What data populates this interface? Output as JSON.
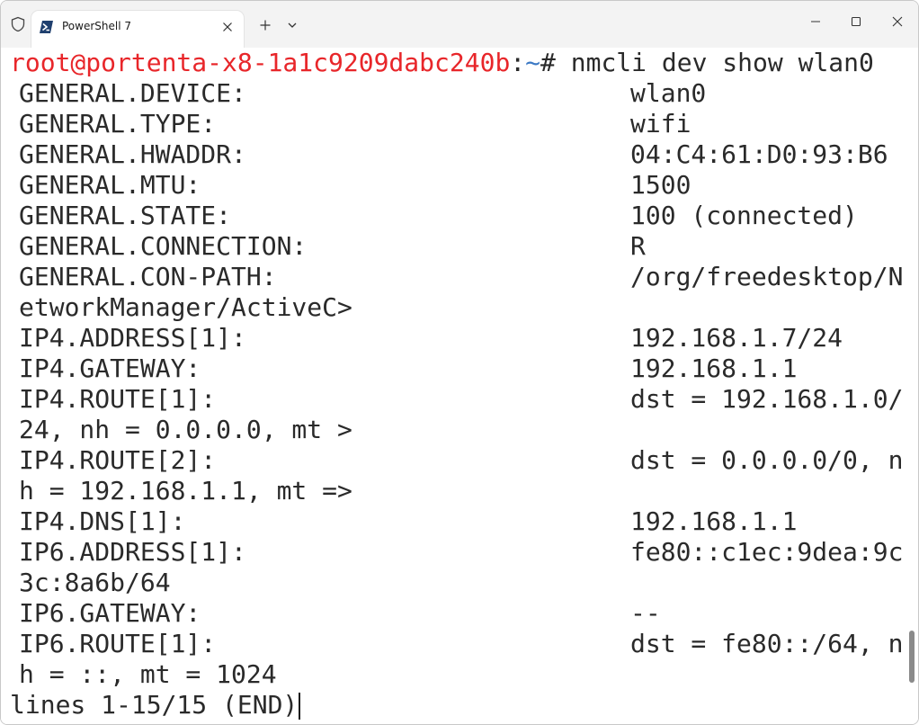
{
  "window": {
    "tab_title": "PowerShell 7",
    "icons": {
      "shield": "shield-icon",
      "tab": "powershell-icon",
      "tab_close": "close-icon",
      "new_tab": "plus-icon",
      "dropdown": "chevron-down-icon",
      "minimize": "minimize-icon",
      "maximize": "maximize-icon",
      "close": "close-window-icon"
    }
  },
  "terminal": {
    "prompt": {
      "user_host": "root@portenta-x8-1a1c9209dabc240b",
      "separator": ":",
      "path": "~",
      "symbol": "#",
      "command": " nmcli dev show wlan0"
    },
    "rows": [
      {
        "key": "GENERAL.DEVICE:",
        "value": "wlan0"
      },
      {
        "key": "GENERAL.TYPE:",
        "value": "wifi"
      },
      {
        "key": "GENERAL.HWADDR:",
        "value": "04:C4:61:D0:93:B6"
      },
      {
        "key": "GENERAL.MTU:",
        "value": "1500"
      },
      {
        "key": "GENERAL.STATE:",
        "value": "100 (connected)"
      },
      {
        "key": "GENERAL.CONNECTION:",
        "value": "R"
      },
      {
        "key": "GENERAL.CON-PATH:",
        "value": "/org/freedesktop/N"
      },
      {
        "key": "etworkManager/ActiveC>",
        "value": ""
      },
      {
        "key": "IP4.ADDRESS[1]:",
        "value": "192.168.1.7/24"
      },
      {
        "key": "IP4.GATEWAY:",
        "value": "192.168.1.1"
      },
      {
        "key": "IP4.ROUTE[1]:",
        "value": "dst = 192.168.1.0/"
      },
      {
        "key": "24, nh = 0.0.0.0, mt >",
        "value": ""
      },
      {
        "key": "IP4.ROUTE[2]:",
        "value": "dst = 0.0.0.0/0, n"
      },
      {
        "key": "h = 192.168.1.1, mt =>",
        "value": ""
      },
      {
        "key": "IP4.DNS[1]:",
        "value": "192.168.1.1"
      },
      {
        "key": "IP6.ADDRESS[1]:",
        "value": "fe80::c1ec:9dea:9c"
      },
      {
        "key": "3c:8a6b/64",
        "value": ""
      },
      {
        "key": "IP6.GATEWAY:",
        "value": "--"
      },
      {
        "key": "IP6.ROUTE[1]:",
        "value": "dst = fe80::/64, n"
      },
      {
        "key": "h = ::, mt = 1024",
        "value": ""
      }
    ],
    "status_line": "lines 1-15/15 (END)"
  },
  "colors": {
    "prompt_user": "#e8262a",
    "prompt_path": "#3b78c4",
    "text": "#2a2a2a",
    "titlebar": "#f3f3f3"
  }
}
